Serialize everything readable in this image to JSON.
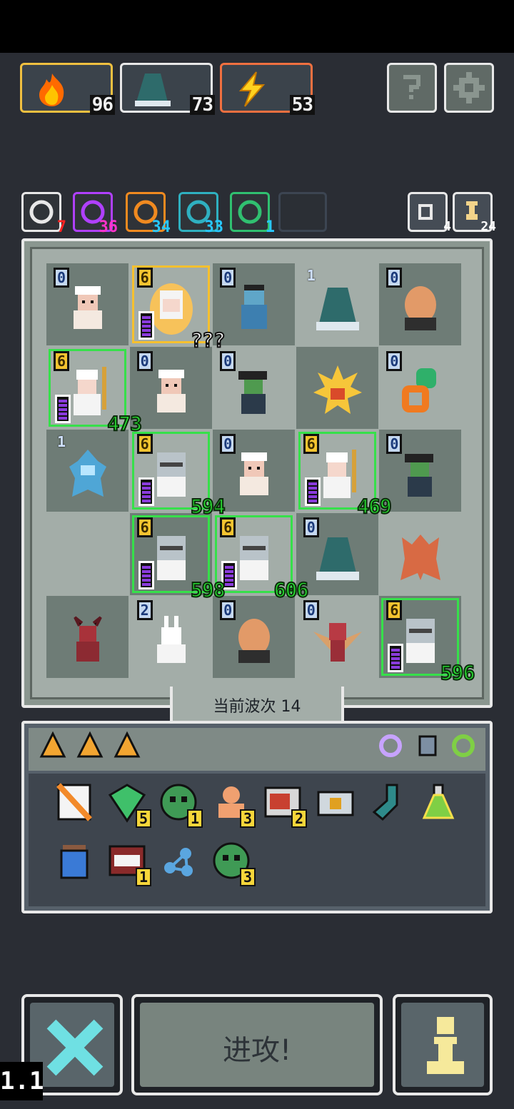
{
  "resources": [
    {
      "name": "fire",
      "value": "96",
      "border": "#f0c040"
    },
    {
      "name": "hood",
      "value": "73",
      "border": "#e8e8e8"
    },
    {
      "name": "lightning",
      "value": "53",
      "border": "#f07040"
    }
  ],
  "buffs": [
    {
      "icon": "sun-face-icon",
      "value": "7",
      "border": "#e8e8e8",
      "color": "#ff2222"
    },
    {
      "icon": "magenta-swirl-icon",
      "value": "36",
      "border": "#b040ff",
      "color": "#ff33cc"
    },
    {
      "icon": "pulse-icon",
      "value": "34",
      "border": "#f08a20",
      "color": "#28c8ff"
    },
    {
      "icon": "cyan-spiral-icon",
      "value": "33",
      "border": "#2fb0c0",
      "color": "#28c8ff"
    },
    {
      "icon": "green-eye-icon",
      "value": "1",
      "border": "#30c070",
      "color": "#28c8ff"
    }
  ],
  "mini_counters": [
    {
      "icon": "reroll-icon",
      "value": "4"
    },
    {
      "icon": "hourglass-icon",
      "value": "24"
    }
  ],
  "board": {
    "cells": [
      {
        "lvl": "0",
        "unit": "king",
        "style": "blue"
      },
      {
        "lvl": "6",
        "unit": "maiden",
        "style": "gold",
        "dmg": "???",
        "dmg_style": "white",
        "bar": 5,
        "sel": "gold"
      },
      {
        "lvl": "0",
        "unit": "zombie",
        "style": "blue"
      },
      {
        "lvl": "1",
        "unit": "hood",
        "style": "plain"
      },
      {
        "lvl": "0",
        "unit": "blob",
        "style": "blue"
      },
      {
        "lvl": "6",
        "unit": "mage",
        "style": "gold",
        "dmg": "473",
        "bar": 5,
        "sel": "green"
      },
      {
        "lvl": "0",
        "unit": "king",
        "style": "blue"
      },
      {
        "lvl": "0",
        "unit": "goblin",
        "style": "blue"
      },
      {
        "lvl": "",
        "unit": "spiky",
        "style": "blue"
      },
      {
        "lvl": "0",
        "unit": "chain",
        "style": "blue"
      },
      {
        "lvl": "1",
        "unit": "iceling",
        "style": "plain"
      },
      {
        "lvl": "6",
        "unit": "knight",
        "style": "gold",
        "dmg": "594",
        "bar": 5,
        "sel": "green"
      },
      {
        "lvl": "0",
        "unit": "king",
        "style": "blue"
      },
      {
        "lvl": "6",
        "unit": "mage",
        "style": "gold",
        "dmg": "469",
        "bar": 5,
        "sel": "green"
      },
      {
        "lvl": "0",
        "unit": "goblin",
        "style": "blue"
      },
      {
        "lvl": "",
        "unit": "",
        "style": "blue"
      },
      {
        "lvl": "6",
        "unit": "knight",
        "style": "gold",
        "dmg": "598",
        "bar": 5,
        "sel": "green"
      },
      {
        "lvl": "6",
        "unit": "knight",
        "style": "gold",
        "dmg": "606",
        "bar": 5,
        "sel": "green"
      },
      {
        "lvl": "0",
        "unit": "hood",
        "style": "blue"
      },
      {
        "lvl": "",
        "unit": "golem",
        "style": "blue"
      },
      {
        "lvl": "",
        "unit": "imp",
        "style": "blue"
      },
      {
        "lvl": "2",
        "unit": "bunny",
        "style": "blue"
      },
      {
        "lvl": "0",
        "unit": "blob",
        "style": "blue"
      },
      {
        "lvl": "0",
        "unit": "bat",
        "style": "blue"
      },
      {
        "lvl": "6",
        "unit": "knight",
        "style": "gold",
        "dmg": "596",
        "bar": 5,
        "sel": "green"
      }
    ]
  },
  "wave_label": "当前波次 14",
  "inventory": {
    "items_row1": [
      {
        "icon": "scroll-icon",
        "count": ""
      },
      {
        "icon": "green-gem-icon",
        "count": "5"
      },
      {
        "icon": "green-slime-icon",
        "count": "1"
      },
      {
        "icon": "bust-icon",
        "count": "3"
      },
      {
        "icon": "oven-icon",
        "count": "2"
      },
      {
        "icon": "camera-icon",
        "count": ""
      },
      {
        "icon": "sock-icon",
        "count": ""
      },
      {
        "icon": "potion-flask-icon",
        "count": ""
      }
    ],
    "items_row2": [
      {
        "icon": "blue-jar-icon",
        "count": ""
      },
      {
        "icon": "mimic-icon",
        "count": "1"
      },
      {
        "icon": "molecule-icon",
        "count": ""
      },
      {
        "icon": "green-slime-icon",
        "count": "3"
      }
    ]
  },
  "attack_label": "进攻!",
  "speed_label": "1.1"
}
